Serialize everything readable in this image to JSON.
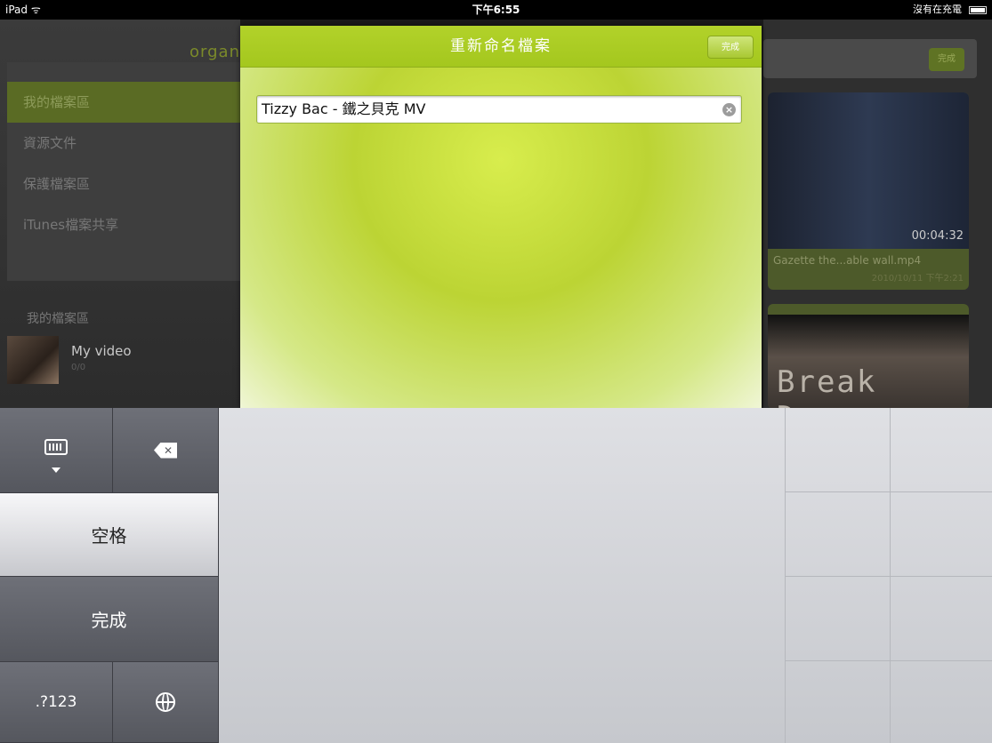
{
  "status_bar": {
    "carrier": "iPad ᯤ",
    "time": "下午6:55",
    "battery_text": "沒有在充電"
  },
  "background": {
    "app_name": "organ",
    "menu": [
      {
        "label": "我的檔案區",
        "active": true
      },
      {
        "label": "資源文件",
        "active": false
      },
      {
        "label": "保護檔案區",
        "active": false
      },
      {
        "label": "iTunes檔案共享",
        "active": false
      }
    ],
    "section_label": "我的檔案區",
    "video": {
      "title": "My video",
      "subtitle": "0/0"
    },
    "toolbar_button": "完成",
    "cards": [
      {
        "duration": "00:04:32",
        "caption": "Gazette the...able wall.mp4",
        "date": "2010/10/11 下午2:21"
      },
      {
        "overlay_text": "Break Down"
      }
    ]
  },
  "modal": {
    "title": "重新命名檔案",
    "header_button": "完成",
    "filename_value": "Tizzy Bac - 鐵之貝克 MV",
    "clear_icon": "clear-circle-icon"
  },
  "keyboard": {
    "space_label": "空格",
    "done_label": "完成",
    "numbers_label": ".?123",
    "icons": {
      "dismiss": "keyboard-dismiss-icon",
      "delete": "delete-key-icon",
      "globe": "globe-icon"
    }
  }
}
